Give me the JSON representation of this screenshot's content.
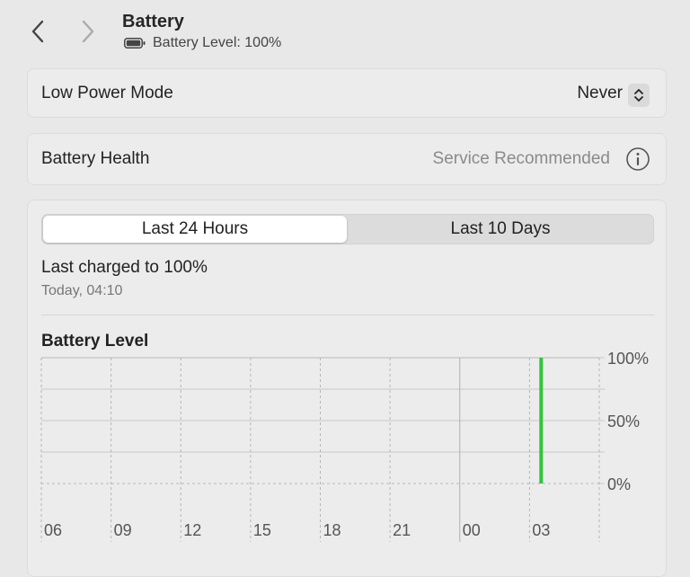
{
  "header": {
    "title": "Battery",
    "subtitle": "Battery Level: 100%",
    "back_icon": "chevron-left-icon",
    "forward_icon": "chevron-right-icon",
    "battery_icon": "battery-full-icon"
  },
  "low_power": {
    "label": "Low Power Mode",
    "value": "Never"
  },
  "health": {
    "label": "Battery Health",
    "value": "Service Recommended"
  },
  "tabs": [
    "Last 24 Hours",
    "Last 10 Days"
  ],
  "selected_tab": "Last 24 Hours",
  "charge": {
    "title": "Last charged to 100%",
    "time": "Today, 04:10"
  },
  "chart_data": {
    "type": "bar",
    "title": "Battery Level",
    "x_tick_labels": [
      "06",
      "09",
      "12",
      "15",
      "18",
      "21",
      "00",
      "03"
    ],
    "y_tick_labels": [
      "100%",
      "50%",
      "0%"
    ],
    "ylim": [
      0,
      100
    ],
    "series": [
      {
        "x": "03:30",
        "value": 100
      }
    ],
    "bar_color": "#30c53a",
    "grid": true
  },
  "colors": {
    "background": "#e8e8e8",
    "card": "#ececec",
    "accent_green": "#30c53a"
  }
}
